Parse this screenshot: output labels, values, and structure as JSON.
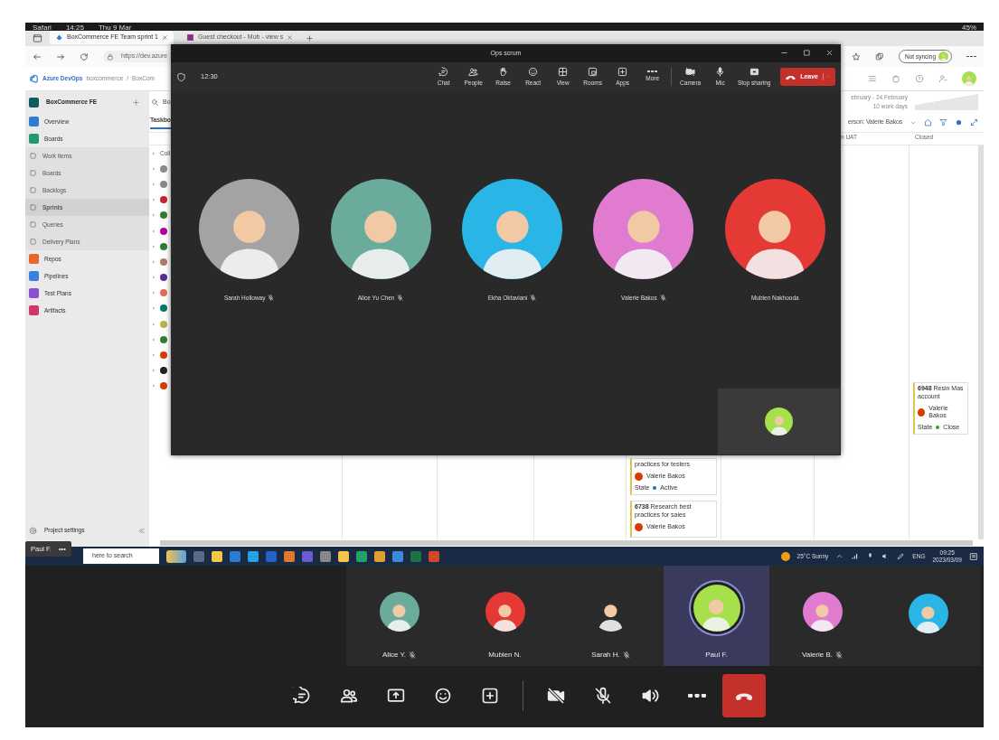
{
  "status_bar": {
    "app": "Safari",
    "time": "14:25",
    "date": "Thu 9 Mar",
    "battery": "45%"
  },
  "browser": {
    "tabs": [
      {
        "title": "BoxCommerce FE Team sprint 1",
        "selected": true
      },
      {
        "title": "Guest checkout - Mob - view s",
        "selected": false
      }
    ],
    "url": "https://dev.azure",
    "sync_button": "Not syncing"
  },
  "devops": {
    "brand": "Azure DevOps",
    "org": "boxcommerce",
    "separator": "/",
    "breadcrumb": "BoxCom",
    "project": "BoxCommerce FE",
    "search": "Bo",
    "tab": "Taskbo",
    "nav": [
      {
        "label": "Overview",
        "kind": "section",
        "color": "#2f7bd6",
        "selected": false
      },
      {
        "label": "Boards",
        "kind": "section",
        "color": "#1f9a6e",
        "selected": false
      },
      {
        "label": "Work items",
        "kind": "sub",
        "selected": false
      },
      {
        "label": "Boards",
        "kind": "sub",
        "selected": false
      },
      {
        "label": "Backlogs",
        "kind": "sub",
        "selected": false
      },
      {
        "label": "Sprints",
        "kind": "sub",
        "selected": true
      },
      {
        "label": "Queries",
        "kind": "sub",
        "selected": false
      },
      {
        "label": "Delivery Plans",
        "kind": "sub",
        "selected": false
      },
      {
        "label": "Repos",
        "kind": "section",
        "color": "#e8652b",
        "selected": false
      },
      {
        "label": "Pipelines",
        "kind": "section",
        "color": "#3a7fe0",
        "selected": false
      },
      {
        "label": "Test Plans",
        "kind": "section",
        "color": "#8a4fd6",
        "selected": false
      },
      {
        "label": "Artifacts",
        "kind": "section",
        "color": "#d1356b",
        "selected": false
      }
    ],
    "settings": "Project settings",
    "date_range": "ebruary - 24 February",
    "work_days": "10 work days",
    "person_filter": "erson: Valerie Bakos",
    "columns": [
      {
        "title": "n UAT"
      },
      {
        "title": "Closed"
      }
    ],
    "tree_rows": [
      {
        "text": "Coll"
      },
      {
        "color": "#8a8a8a"
      },
      {
        "color": "#8a8a8a"
      },
      {
        "color": "#c0262d"
      },
      {
        "color": "#2e7d32"
      },
      {
        "color": "#b4009e"
      },
      {
        "color": "#2e7d32"
      },
      {
        "color": "#b07a6a"
      },
      {
        "color": "#5c2d91"
      },
      {
        "color": "#e06c5a"
      },
      {
        "color": "#00796b"
      },
      {
        "color": "#b5b543"
      },
      {
        "color": "#2e7d32"
      },
      {
        "color": "#d83b01"
      },
      {
        "color": "#222222"
      },
      {
        "color": "#d83b01"
      }
    ],
    "cards": [
      {
        "title": "practices for testers",
        "assignee": "Valerie Bakos",
        "state_label": "State",
        "state": "Active"
      },
      {
        "id": "6738",
        "title": "Research best practices for sales",
        "assignee": "Valerie Bakos"
      },
      {
        "id": "6948",
        "title": "Resin Mas account",
        "assignee": "Valerie Bakos",
        "state_label": "State",
        "state": "Close"
      }
    ]
  },
  "meeting_window": {
    "title": "Ops scrum",
    "timer": "12:30",
    "toolbar": [
      {
        "kind": "chat",
        "label": "Chat"
      },
      {
        "kind": "people",
        "label": "People"
      },
      {
        "kind": "raise",
        "label": "Raise"
      },
      {
        "kind": "react",
        "label": "React"
      },
      {
        "kind": "view",
        "label": "View"
      },
      {
        "kind": "rooms",
        "label": "Rooms"
      },
      {
        "kind": "apps",
        "label": "Apps"
      },
      {
        "kind": "more",
        "label": "More"
      },
      {
        "kind": "camera",
        "label": "Camera"
      },
      {
        "kind": "mic",
        "label": "Mic"
      },
      {
        "kind": "share",
        "label": "Stop sharing"
      }
    ],
    "leave_button": "Leave",
    "participants": [
      {
        "name": "Sarah Holloway",
        "muted": true,
        "color": "#a3a3a3"
      },
      {
        "name": "Alice Yu Chen",
        "muted": true,
        "color": "#6aab9c"
      },
      {
        "name": "Ekha Oktaviani",
        "muted": true,
        "color": "#29b6e6"
      },
      {
        "name": "Valerie Bakos",
        "muted": true,
        "color": "#e07bd0"
      },
      {
        "name": "Mubien Nakhooda",
        "muted": false,
        "color": "#e53935"
      }
    ],
    "self_view": {
      "color": "#a6e04a"
    }
  },
  "taskbar": {
    "search": "here to search",
    "weather": "25°C Sunny",
    "language": "ENG",
    "time": "09:25",
    "date": "2023/03/09"
  },
  "presenter_label": {
    "name": "Paul F.",
    "more": "•••"
  },
  "meeting": {
    "tiles": [
      {
        "name": "Alice Y.",
        "muted": true,
        "color": "#6aab9c",
        "selected": false
      },
      {
        "name": "Mubien N.",
        "muted": false,
        "color": "#e53935",
        "selected": false
      },
      {
        "name": "Sarah H.",
        "muted": true,
        "color": "#2b2b2b",
        "selected": false
      },
      {
        "name": "Paul F.",
        "muted": false,
        "color": "#a6e04a",
        "selected": true
      },
      {
        "name": "Valerie B.",
        "muted": true,
        "color": "#e07bd0",
        "selected": false
      },
      {
        "muted": false,
        "color": "#29b6e6",
        "selected": false
      }
    ],
    "controls": [
      {
        "kind": "chat"
      },
      {
        "kind": "people"
      },
      {
        "kind": "share"
      },
      {
        "kind": "react"
      },
      {
        "kind": "apps"
      },
      {
        "kind": "camera-off"
      },
      {
        "kind": "mic-off"
      },
      {
        "kind": "speaker"
      },
      {
        "kind": "more"
      },
      {
        "kind": "hangup"
      }
    ]
  }
}
